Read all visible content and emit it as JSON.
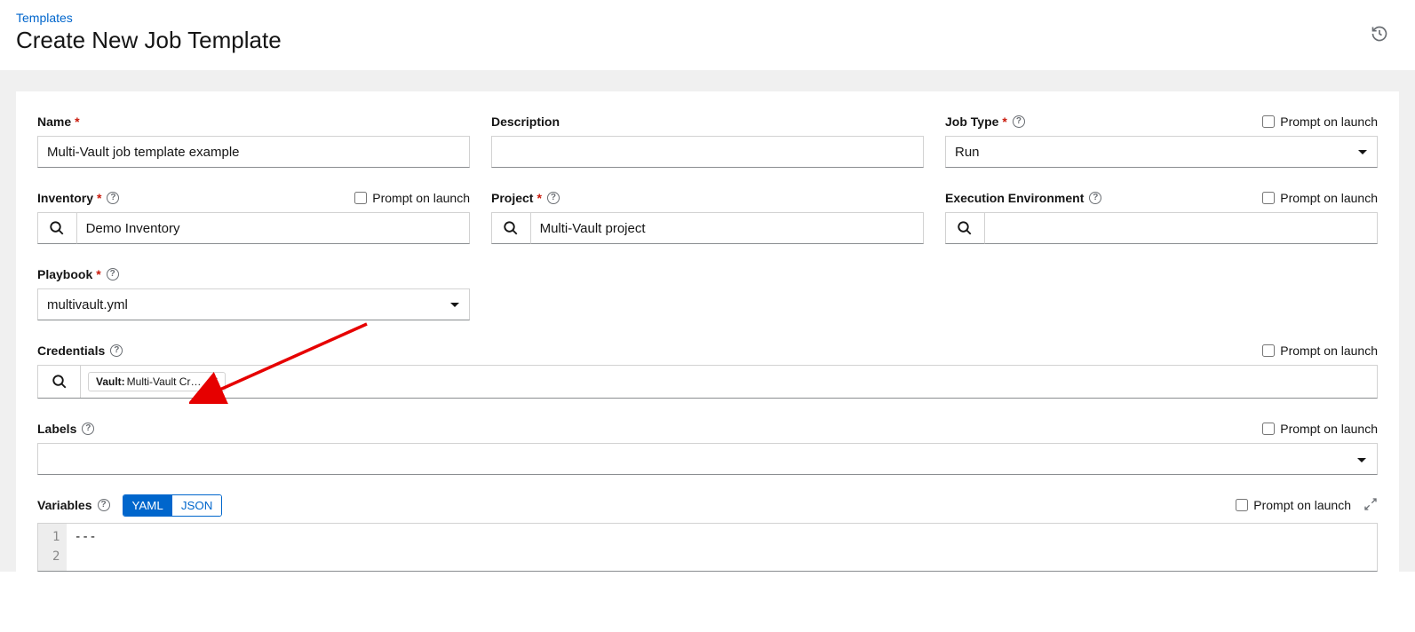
{
  "breadcrumb": "Templates",
  "page_title": "Create New Job Template",
  "prompt_label": "Prompt on launch",
  "fields": {
    "name": {
      "label": "Name",
      "value": "Multi-Vault job template example"
    },
    "description": {
      "label": "Description",
      "value": ""
    },
    "job_type": {
      "label": "Job Type",
      "value": "Run"
    },
    "inventory": {
      "label": "Inventory",
      "value": "Demo Inventory"
    },
    "project": {
      "label": "Project",
      "value": "Multi-Vault project"
    },
    "exec_env": {
      "label": "Execution Environment",
      "value": ""
    },
    "playbook": {
      "label": "Playbook",
      "value": "multivault.yml"
    },
    "credentials": {
      "label": "Credentials",
      "chip_prefix": "Vault:",
      "chip_text": "Multi-Vault Cre..."
    },
    "labels": {
      "label": "Labels"
    },
    "variables": {
      "label": "Variables",
      "yaml": "YAML",
      "json": "JSON",
      "line1": "---"
    }
  }
}
